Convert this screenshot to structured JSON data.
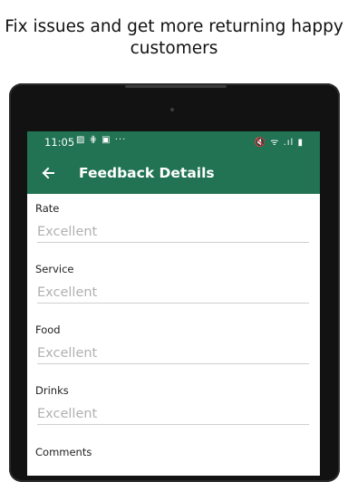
{
  "headline": {
    "line1": "Fix issues and get more returning happy",
    "line2": "customers"
  },
  "statusbar": {
    "time": "11:05",
    "left_icons": "▨ ⋕ ▣ ···",
    "right_icons": "🔇 ᯤ .ıl ▮"
  },
  "appbar": {
    "back_icon": "arrow-left-icon",
    "title": "Feedback Details"
  },
  "fields": [
    {
      "label": "Rate",
      "placeholder": "Excellent"
    },
    {
      "label": "Service",
      "placeholder": "Excellent"
    },
    {
      "label": "Food",
      "placeholder": "Excellent"
    },
    {
      "label": "Drinks",
      "placeholder": "Excellent"
    },
    {
      "label": "Comments",
      "placeholder": ""
    }
  ],
  "colors": {
    "primary": "#217354"
  }
}
